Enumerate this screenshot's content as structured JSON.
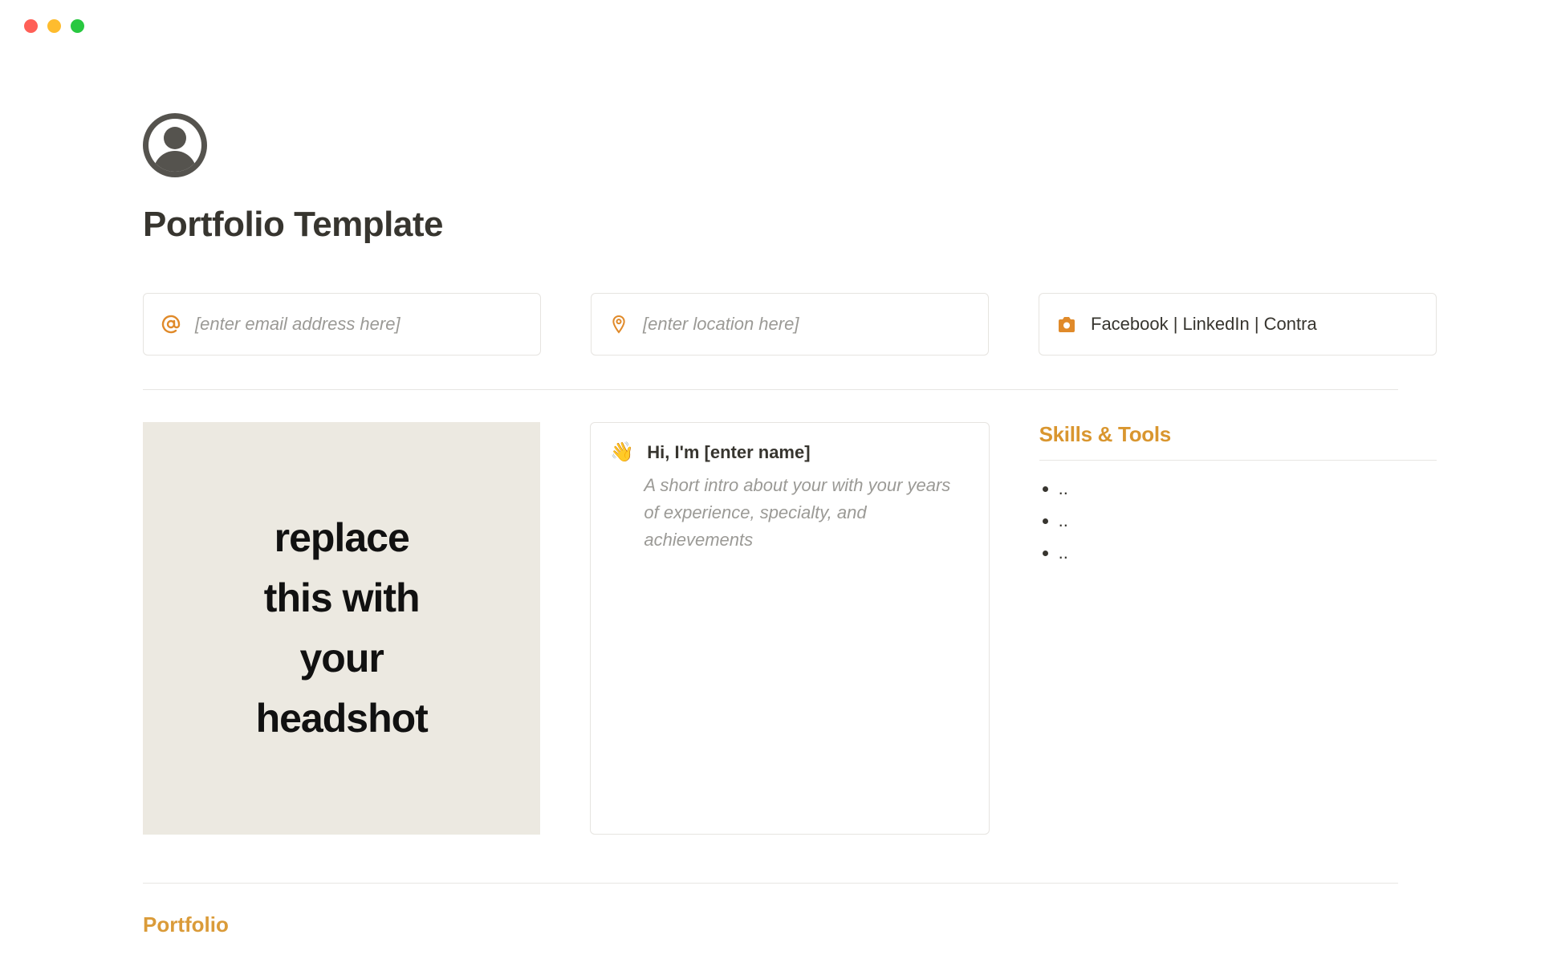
{
  "window": {
    "traffic_lights": [
      "red",
      "yellow",
      "green"
    ]
  },
  "page": {
    "title": "Portfolio Template"
  },
  "info_cards": {
    "email_placeholder": "[enter email address here]",
    "location_placeholder": "[enter location here]",
    "social_text": "Facebook | LinkedIn | Contra"
  },
  "headshot": {
    "placeholder_text": "replace\nthis with\nyour\nheadshot"
  },
  "intro": {
    "wave_emoji": "👋",
    "greeting": "Hi, I'm [enter name]",
    "body": "A short intro about your with your years of experience, specialty, and achievements"
  },
  "skills": {
    "heading": "Skills & Tools",
    "items": [
      "..",
      "..",
      ".."
    ]
  },
  "sections": {
    "portfolio_heading": "Portfolio"
  },
  "colors": {
    "accent": "#d9962f",
    "icon_orange": "#e08a2a"
  }
}
